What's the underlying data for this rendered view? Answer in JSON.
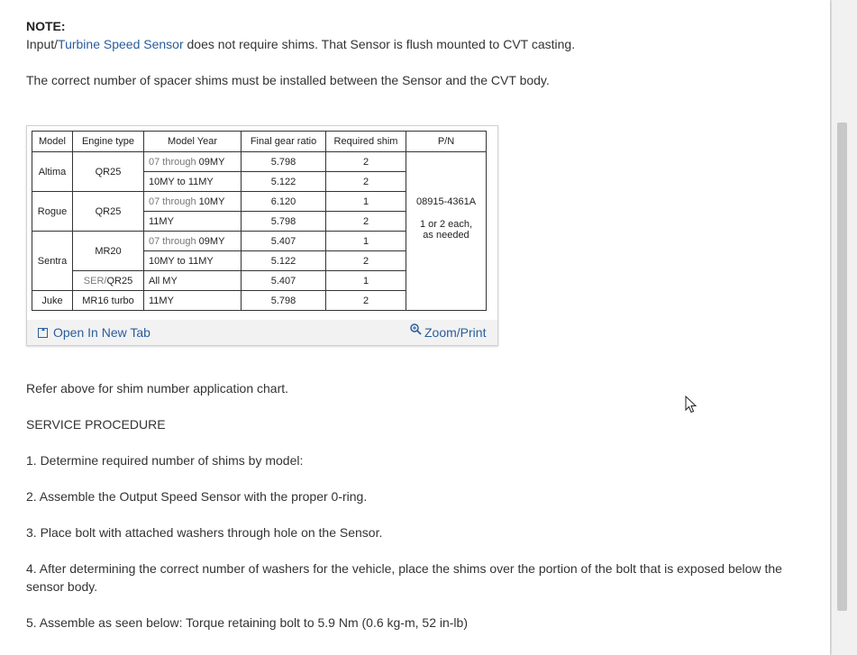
{
  "note": {
    "title": "NOTE:",
    "line1_prefix": "Input/",
    "line1_link": "Turbine Speed Sensor",
    "line1_suffix": " does not require shims. That Sensor is flush mounted to CVT casting.",
    "line2": "The correct number of spacer shims must be installed between the Sensor and the CVT body."
  },
  "table": {
    "headers": [
      "Model",
      "Engine type",
      "Model Year",
      "Final gear ratio",
      "Required shim",
      "P/N"
    ],
    "rows": [
      {
        "model": "Altima",
        "engine": "QR25",
        "year_from": "07",
        "year_word": " through ",
        "year_to": "09MY",
        "ratio": "5.798",
        "shim": "2"
      },
      {
        "year": "10MY to 11MY",
        "ratio": "5.122",
        "shim": "2"
      },
      {
        "model": "Rogue",
        "engine": "QR25",
        "year_from": "07",
        "year_word": " through ",
        "year_to": "10MY",
        "ratio": "6.120",
        "shim": "1"
      },
      {
        "year": "11MY",
        "ratio": "5.798",
        "shim": "2"
      },
      {
        "model": "Sentra",
        "engine": "MR20",
        "year_from": "07",
        "year_word": " through ",
        "year_to": "09MY",
        "ratio": "5.407",
        "shim": "1"
      },
      {
        "year": "10MY to 11MY",
        "ratio": "5.122",
        "shim": "2"
      },
      {
        "engine_prefix": "SER/",
        "engine": "QR25",
        "year": "All MY",
        "ratio": "5.407",
        "shim": "1"
      },
      {
        "model": "Juke",
        "engine": "MR16 turbo",
        "year": "11MY",
        "ratio": "5.798",
        "shim": "2"
      }
    ],
    "pn": "08915-4361A",
    "pn_note_1": "1 or 2 each,",
    "pn_note_2": "as needed"
  },
  "figure_toolbar": {
    "open_label": "Open In New Tab",
    "zoom_label": "Zoom/Print"
  },
  "body": {
    "refer": "Refer above for shim number application chart.",
    "heading": "SERVICE PROCEDURE",
    "step1": "1. Determine required number of shims by model:",
    "step2": "2. Assemble the Output Speed Sensor with the proper 0-ring.",
    "step3": "3. Place bolt with attached washers through hole on the Sensor.",
    "step4_line1": "4. After determining the correct number of washers for the vehicle, place the shims over the portion of the bolt that is exposed below the",
    "step4_line2": "sensor body.",
    "step5": "5. Assemble as seen below: Torque retaining bolt to 5.9 Nm (0.6 kg-m, 52 in-lb)"
  },
  "icons": {
    "open": "open-new-tab-icon",
    "zoom": "zoom-icon",
    "cursor": "mouse-cursor-icon"
  }
}
